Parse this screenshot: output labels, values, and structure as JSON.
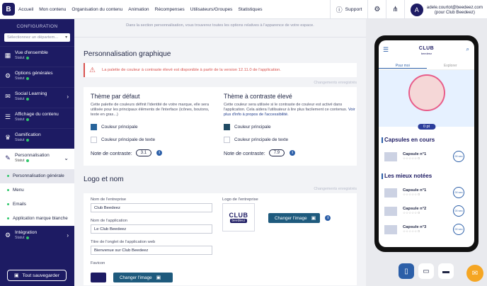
{
  "topbar": {
    "nav": [
      "Accueil",
      "Mon contenu",
      "Organisation du contenu",
      "Animation",
      "Récompenses",
      "Utilisateurs/Groupes",
      "Statistiques"
    ],
    "support": "Support",
    "user_email": "adele.courtot@beedeez.com",
    "user_org": "(pour Club Beedeez)",
    "avatar": "A"
  },
  "sidebar": {
    "title": "CONFIGURATION",
    "select_placeholder": "Sélectionnez un départem...",
    "status_label": "Statut",
    "items": [
      {
        "label": "Vue d'ensemble",
        "icon": "grid-icon"
      },
      {
        "label": "Options générales",
        "icon": "gear-icon"
      },
      {
        "label": "Social Learning",
        "icon": "chat-icon"
      },
      {
        "label": "Affichage du contenu",
        "icon": "list-icon"
      },
      {
        "label": "Gamification",
        "icon": "trophy-icon"
      },
      {
        "label": "Personnalisation",
        "icon": "palette-icon"
      },
      {
        "label": "Intégration",
        "icon": "plug-icon"
      }
    ],
    "subitems": [
      "Personnalisation générale",
      "Menu",
      "Emails",
      "Application marque blanche"
    ],
    "save_all": "Tout sauvegarder"
  },
  "main": {
    "intro": "Dans la section personnalisation, vous trouverez toutes les options relatives à l'apparence de votre espace.",
    "section1": "Personnalisation graphique",
    "alert": "La palette de couleur à contraste élevé est disponible à partir de la version 12.11.0 de l'application.",
    "saved": "Changements enregistrés",
    "default_theme": {
      "title": "Thème par défaut",
      "desc": "Cette palette de couleurs définit l'identité de votre marque, elle sera utilisée pour les principaux éléments de l'interface (icônes, boutons, texte en gras...)",
      "primary": "Couleur principale",
      "primary_text": "Couleur principale de texte",
      "contrast_label": "Note de contraste:",
      "contrast_value": "3.1"
    },
    "contrast_theme": {
      "title": "Thème à contraste élevé",
      "desc": "Cette couleur sera utilisée si le contraste de couleur est activé dans l'application. Cela aidera l'utilisateur à lire plus facilement ce contenus.",
      "link": "Voir plus d'info à propos de l'accessibilité.",
      "primary": "Couleur principale",
      "primary_text": "Couleur principale de texte",
      "contrast_label": "Note de contraste:",
      "contrast_value": "7.9"
    },
    "section2": "Logo et nom",
    "company_label": "Nom de l'entreprise",
    "company_value": "Club Beedeez",
    "app_label": "Nom de l'application",
    "app_value": "Le Club Beedeez",
    "tab_label": "Titre de l'onglet de l'application web",
    "tab_value": "Bienvenue sur Club Beedeez",
    "logo_label": "Logo de l'entreprise",
    "logo_text": "CLUB",
    "logo_sub": "beedeez",
    "change_image": "Changer l'image",
    "favicon_label": "Favicon"
  },
  "phone": {
    "logo": "CLUB",
    "logo_sub": "beedeez",
    "tabs": [
      "Pour moi",
      "Explorer"
    ],
    "points": "0 pt",
    "section1": "Capsules en cours",
    "section2": "Les mieux notées",
    "count": "0",
    "caps": [
      "Capsule n°1"
    ],
    "top": [
      "Capsule n°1",
      "Capsule n°2",
      "Capsule n°3"
    ],
    "sec": "00 sec"
  },
  "colors": {
    "brand": "#1d1b63",
    "alert": "#d9534f",
    "accent": "#2c5fa8"
  }
}
